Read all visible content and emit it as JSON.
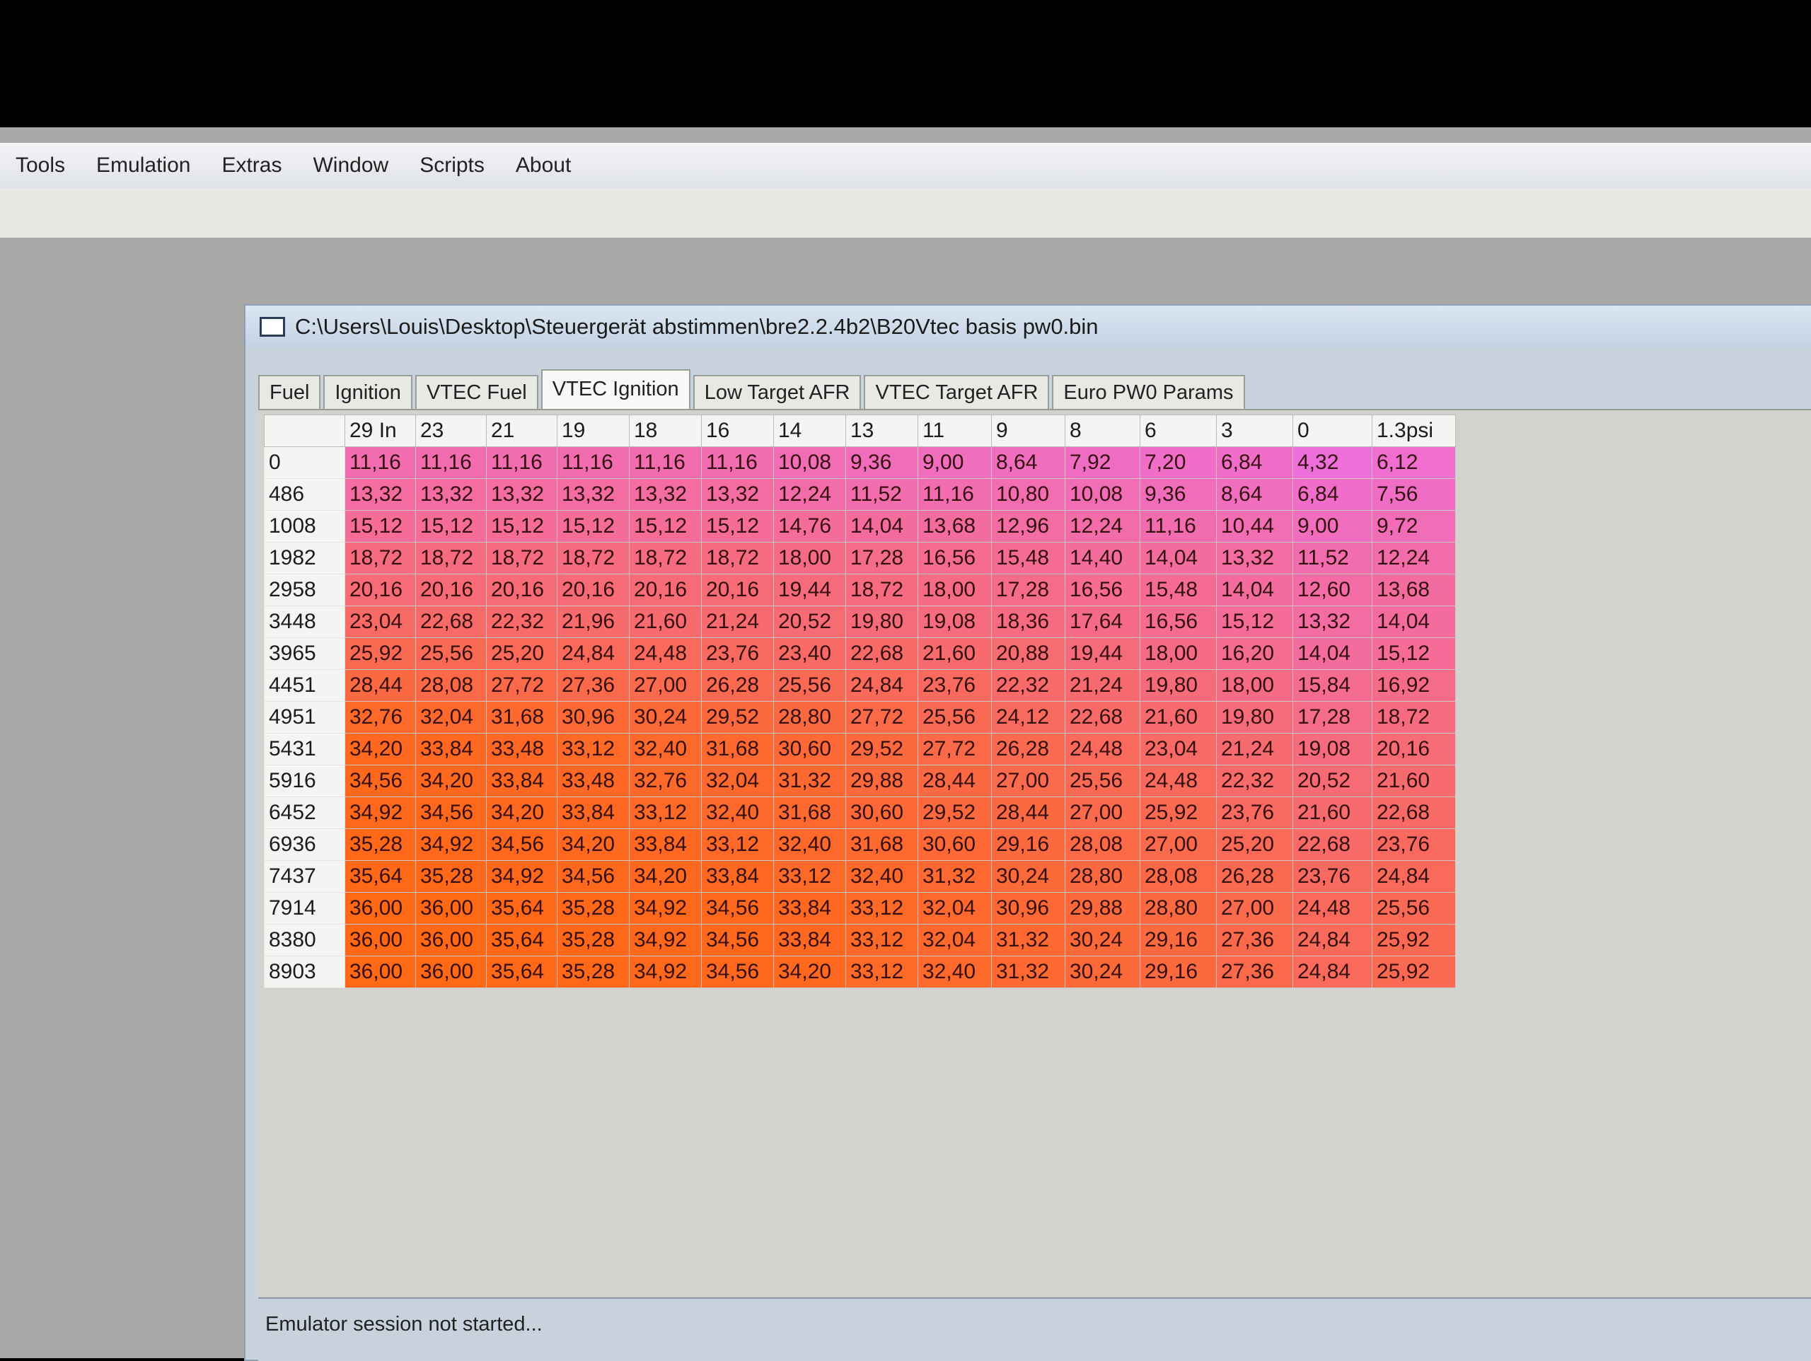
{
  "menubar": {
    "items": [
      "Tools",
      "Emulation",
      "Extras",
      "Window",
      "Scripts",
      "About"
    ]
  },
  "window": {
    "title": "C:\\Users\\Louis\\Desktop\\Steuergerät abstimmen\\bre2.2.4b2\\B20Vtec basis pw0.bin"
  },
  "tabs": [
    "Fuel",
    "Ignition",
    "VTEC Fuel",
    "VTEC Ignition",
    "Low Target AFR",
    "VTEC Target AFR",
    "Euro PW0 Params"
  ],
  "active_tab": "VTEC Ignition",
  "table": {
    "corner": "",
    "columns": [
      "29 In",
      "23",
      "21",
      "19",
      "18",
      "16",
      "14",
      "13",
      "11",
      "9",
      "8",
      "6",
      "3",
      "0",
      "1.3psi"
    ],
    "rows": [
      {
        "rpm": "0",
        "values": [
          "11,16",
          "11,16",
          "11,16",
          "11,16",
          "11,16",
          "11,16",
          "10,08",
          "9,36",
          "9,00",
          "8,64",
          "7,92",
          "7,20",
          "6,84",
          "4,32",
          "6,12"
        ]
      },
      {
        "rpm": "486",
        "values": [
          "13,32",
          "13,32",
          "13,32",
          "13,32",
          "13,32",
          "13,32",
          "12,24",
          "11,52",
          "11,16",
          "10,80",
          "10,08",
          "9,36",
          "8,64",
          "6,84",
          "7,56"
        ]
      },
      {
        "rpm": "1008",
        "values": [
          "15,12",
          "15,12",
          "15,12",
          "15,12",
          "15,12",
          "15,12",
          "14,76",
          "14,04",
          "13,68",
          "12,96",
          "12,24",
          "11,16",
          "10,44",
          "9,00",
          "9,72"
        ]
      },
      {
        "rpm": "1982",
        "values": [
          "18,72",
          "18,72",
          "18,72",
          "18,72",
          "18,72",
          "18,72",
          "18,00",
          "17,28",
          "16,56",
          "15,48",
          "14,40",
          "14,04",
          "13,32",
          "11,52",
          "12,24"
        ]
      },
      {
        "rpm": "2958",
        "values": [
          "20,16",
          "20,16",
          "20,16",
          "20,16",
          "20,16",
          "20,16",
          "19,44",
          "18,72",
          "18,00",
          "17,28",
          "16,56",
          "15,48",
          "14,04",
          "12,60",
          "13,68"
        ]
      },
      {
        "rpm": "3448",
        "values": [
          "23,04",
          "22,68",
          "22,32",
          "21,96",
          "21,60",
          "21,24",
          "20,52",
          "19,80",
          "19,08",
          "18,36",
          "17,64",
          "16,56",
          "15,12",
          "13,32",
          "14,04"
        ]
      },
      {
        "rpm": "3965",
        "values": [
          "25,92",
          "25,56",
          "25,20",
          "24,84",
          "24,48",
          "23,76",
          "23,40",
          "22,68",
          "21,60",
          "20,88",
          "19,44",
          "18,00",
          "16,20",
          "14,04",
          "15,12"
        ]
      },
      {
        "rpm": "4451",
        "values": [
          "28,44",
          "28,08",
          "27,72",
          "27,36",
          "27,00",
          "26,28",
          "25,56",
          "24,84",
          "23,76",
          "22,32",
          "21,24",
          "19,80",
          "18,00",
          "15,84",
          "16,92"
        ]
      },
      {
        "rpm": "4951",
        "values": [
          "32,76",
          "32,04",
          "31,68",
          "30,96",
          "30,24",
          "29,52",
          "28,80",
          "27,72",
          "25,56",
          "24,12",
          "22,68",
          "21,60",
          "19,80",
          "17,28",
          "18,72"
        ]
      },
      {
        "rpm": "5431",
        "values": [
          "34,20",
          "33,84",
          "33,48",
          "33,12",
          "32,40",
          "31,68",
          "30,60",
          "29,52",
          "27,72",
          "26,28",
          "24,48",
          "23,04",
          "21,24",
          "19,08",
          "20,16"
        ]
      },
      {
        "rpm": "5916",
        "values": [
          "34,56",
          "34,20",
          "33,84",
          "33,48",
          "32,76",
          "32,04",
          "31,32",
          "29,88",
          "28,44",
          "27,00",
          "25,56",
          "24,48",
          "22,32",
          "20,52",
          "21,60"
        ]
      },
      {
        "rpm": "6452",
        "values": [
          "34,92",
          "34,56",
          "34,20",
          "33,84",
          "33,12",
          "32,40",
          "31,68",
          "30,60",
          "29,52",
          "28,44",
          "27,00",
          "25,92",
          "23,76",
          "21,60",
          "22,68"
        ]
      },
      {
        "rpm": "6936",
        "values": [
          "35,28",
          "34,92",
          "34,56",
          "34,20",
          "33,84",
          "33,12",
          "32,40",
          "31,68",
          "30,60",
          "29,16",
          "28,08",
          "27,00",
          "25,20",
          "22,68",
          "23,76"
        ]
      },
      {
        "rpm": "7437",
        "values": [
          "35,64",
          "35,28",
          "34,92",
          "34,56",
          "34,20",
          "33,84",
          "33,12",
          "32,40",
          "31,32",
          "30,24",
          "28,80",
          "28,08",
          "26,28",
          "23,76",
          "24,84"
        ]
      },
      {
        "rpm": "7914",
        "values": [
          "36,00",
          "36,00",
          "35,64",
          "35,28",
          "34,92",
          "34,56",
          "33,84",
          "33,12",
          "32,04",
          "30,96",
          "29,88",
          "28,80",
          "27,00",
          "24,48",
          "25,56"
        ]
      },
      {
        "rpm": "8380",
        "values": [
          "36,00",
          "36,00",
          "35,64",
          "35,28",
          "34,92",
          "34,56",
          "33,84",
          "33,12",
          "32,04",
          "31,32",
          "30,24",
          "29,16",
          "27,36",
          "24,84",
          "25,92"
        ]
      },
      {
        "rpm": "8903",
        "values": [
          "36,00",
          "36,00",
          "35,64",
          "35,28",
          "34,92",
          "34,56",
          "34,20",
          "33,12",
          "32,40",
          "31,32",
          "30,24",
          "29,16",
          "27,36",
          "24,84",
          "25,92"
        ]
      }
    ]
  },
  "status": {
    "text": "Emulator session not started..."
  }
}
